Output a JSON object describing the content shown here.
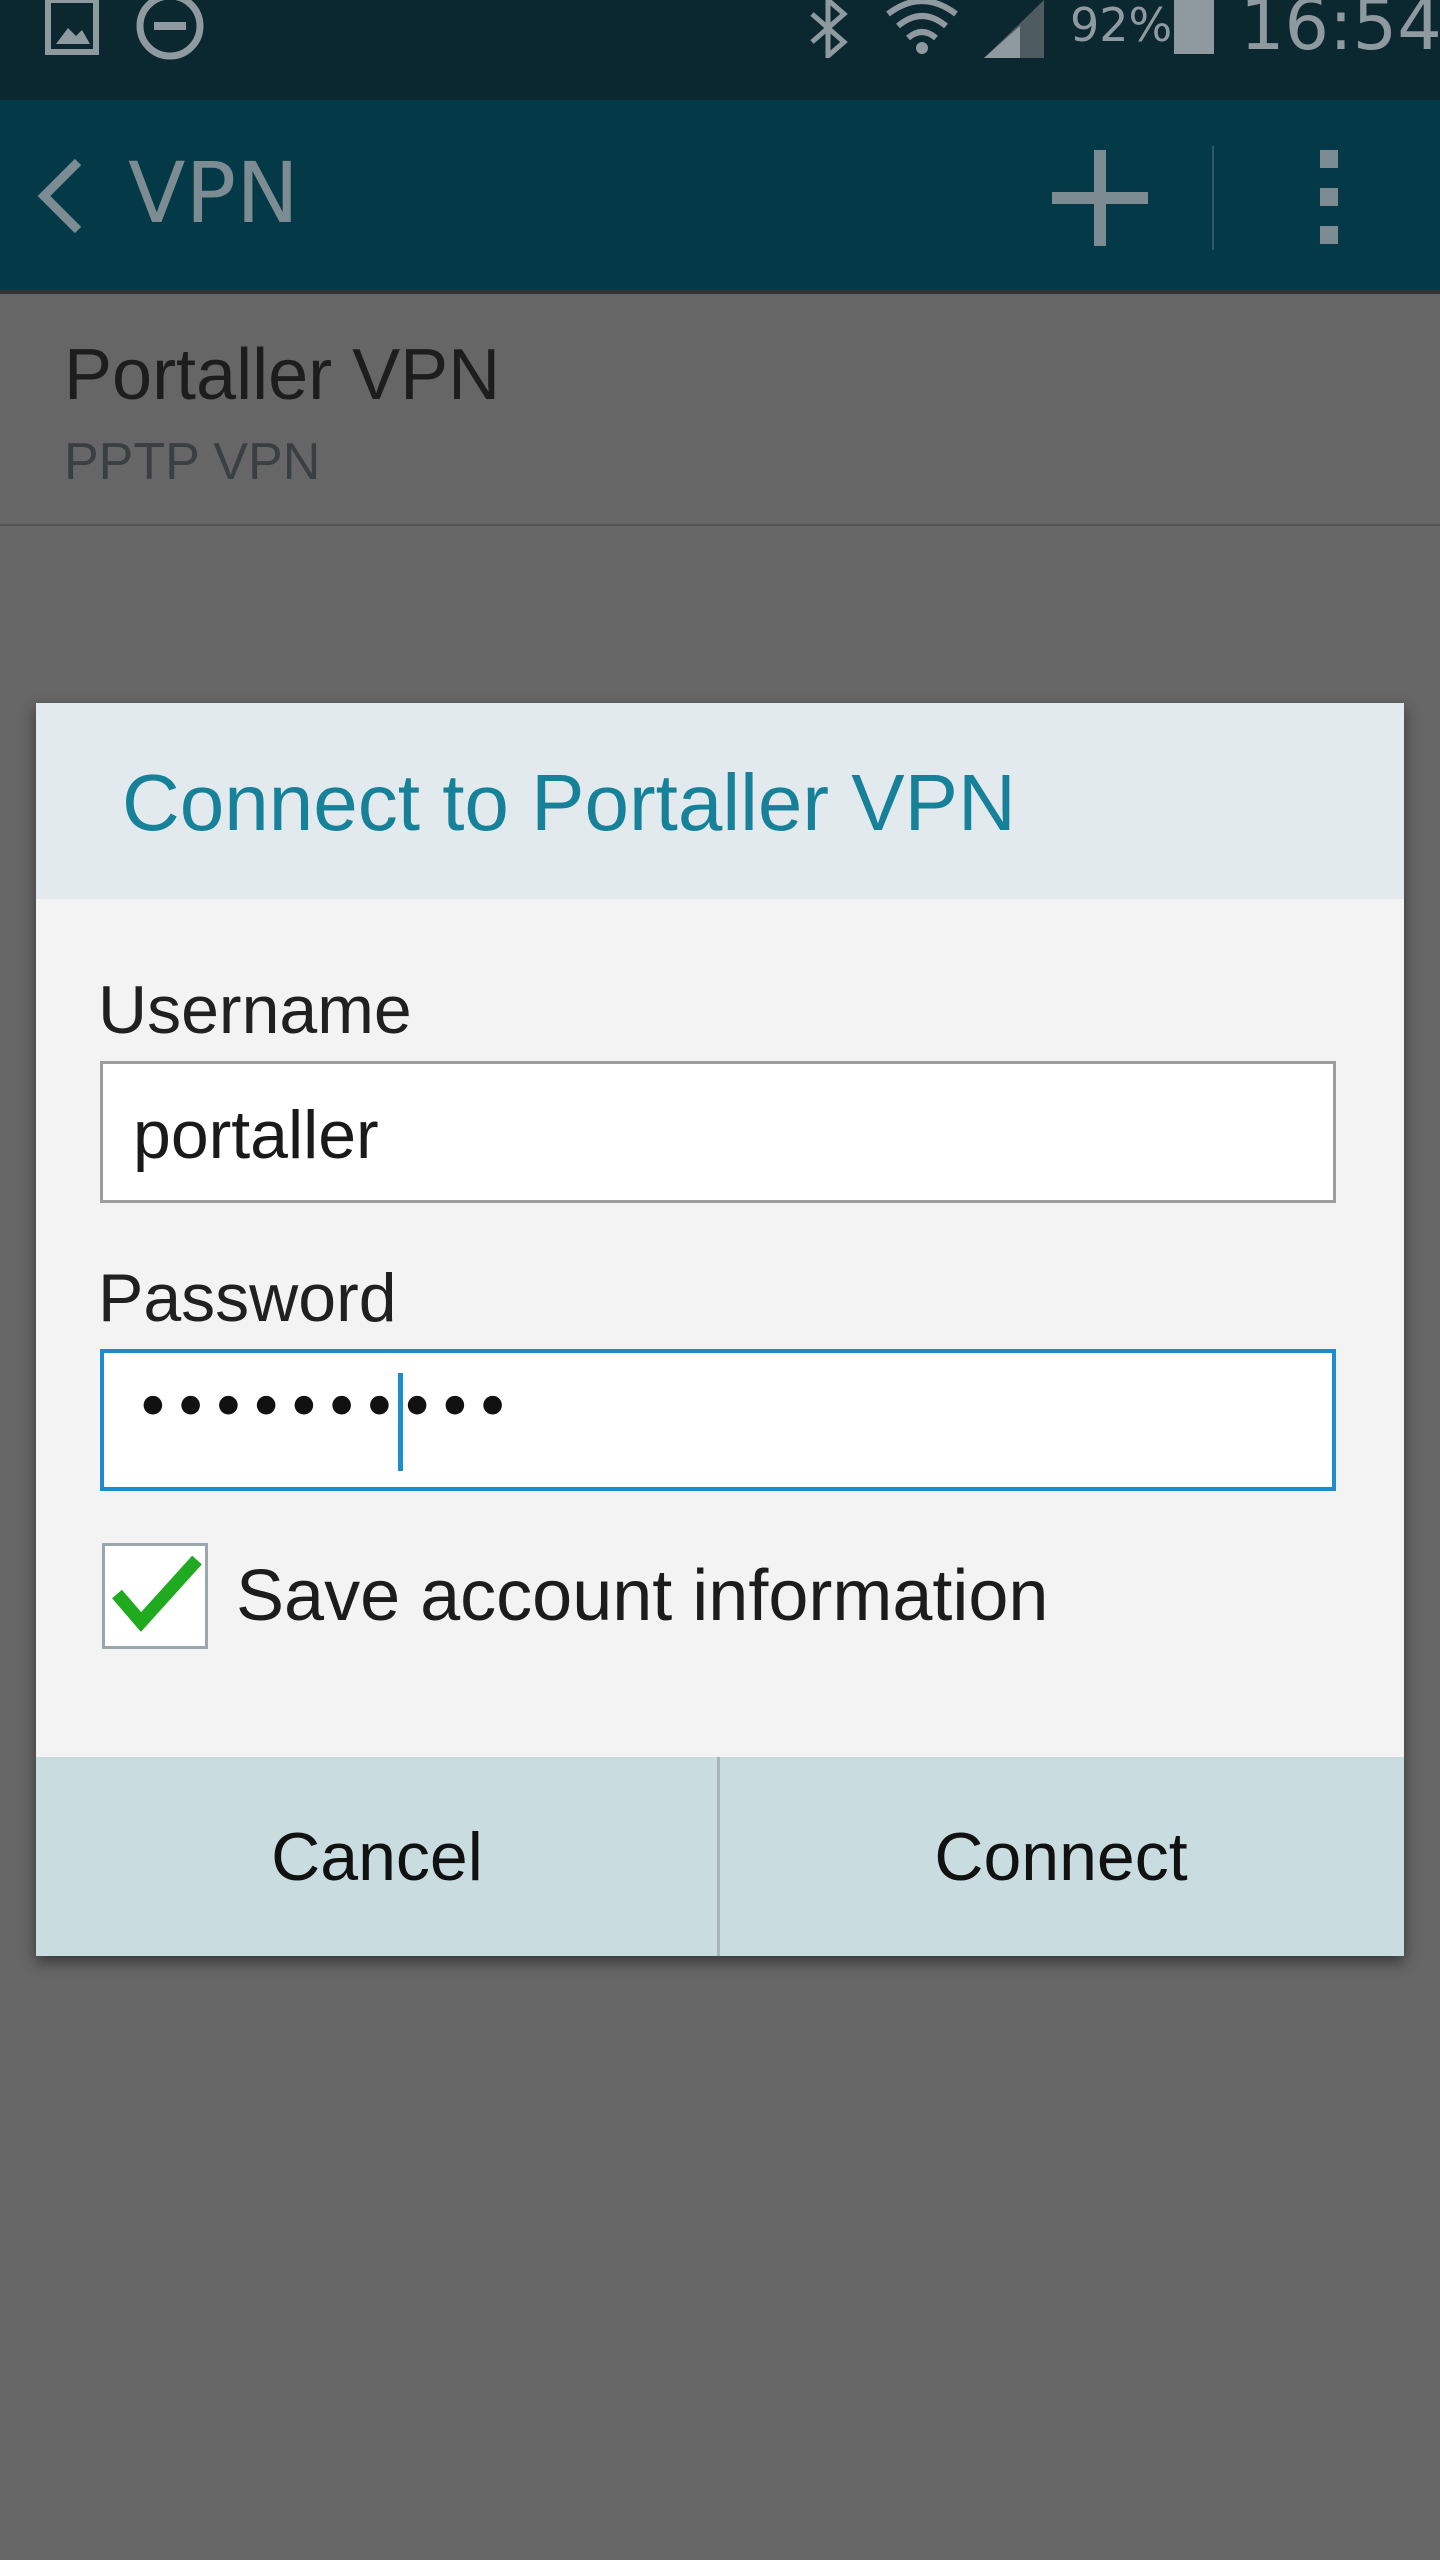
{
  "status_bar": {
    "battery_percent": "92%",
    "time": "16:54",
    "icons": [
      "gallery-icon",
      "do-not-disturb-icon",
      "bluetooth-icon",
      "wifi-icon",
      "signal-icon",
      "battery-icon"
    ]
  },
  "action_bar": {
    "title": "VPN",
    "icons": [
      "back-icon",
      "add-icon",
      "overflow-menu-icon"
    ]
  },
  "vpn_list": {
    "items": [
      {
        "name": "Portaller VPN",
        "type": "PPTP VPN"
      }
    ]
  },
  "dialog": {
    "title": "Connect to Portaller VPN",
    "username_label": "Username",
    "username_value": "portaller",
    "password_label": "Password",
    "password_value": "••••••••••",
    "save_checkbox_label": "Save account information",
    "save_checked": true,
    "cancel_label": "Cancel",
    "connect_label": "Connect"
  },
  "colors": {
    "status_bar_bg": "#0b2730",
    "action_bar_bg": "#043a47",
    "dialog_title": "#17819a",
    "focus_border": "#1d8ccc",
    "check_mark": "#1faa1f",
    "scrim": "#666666"
  }
}
